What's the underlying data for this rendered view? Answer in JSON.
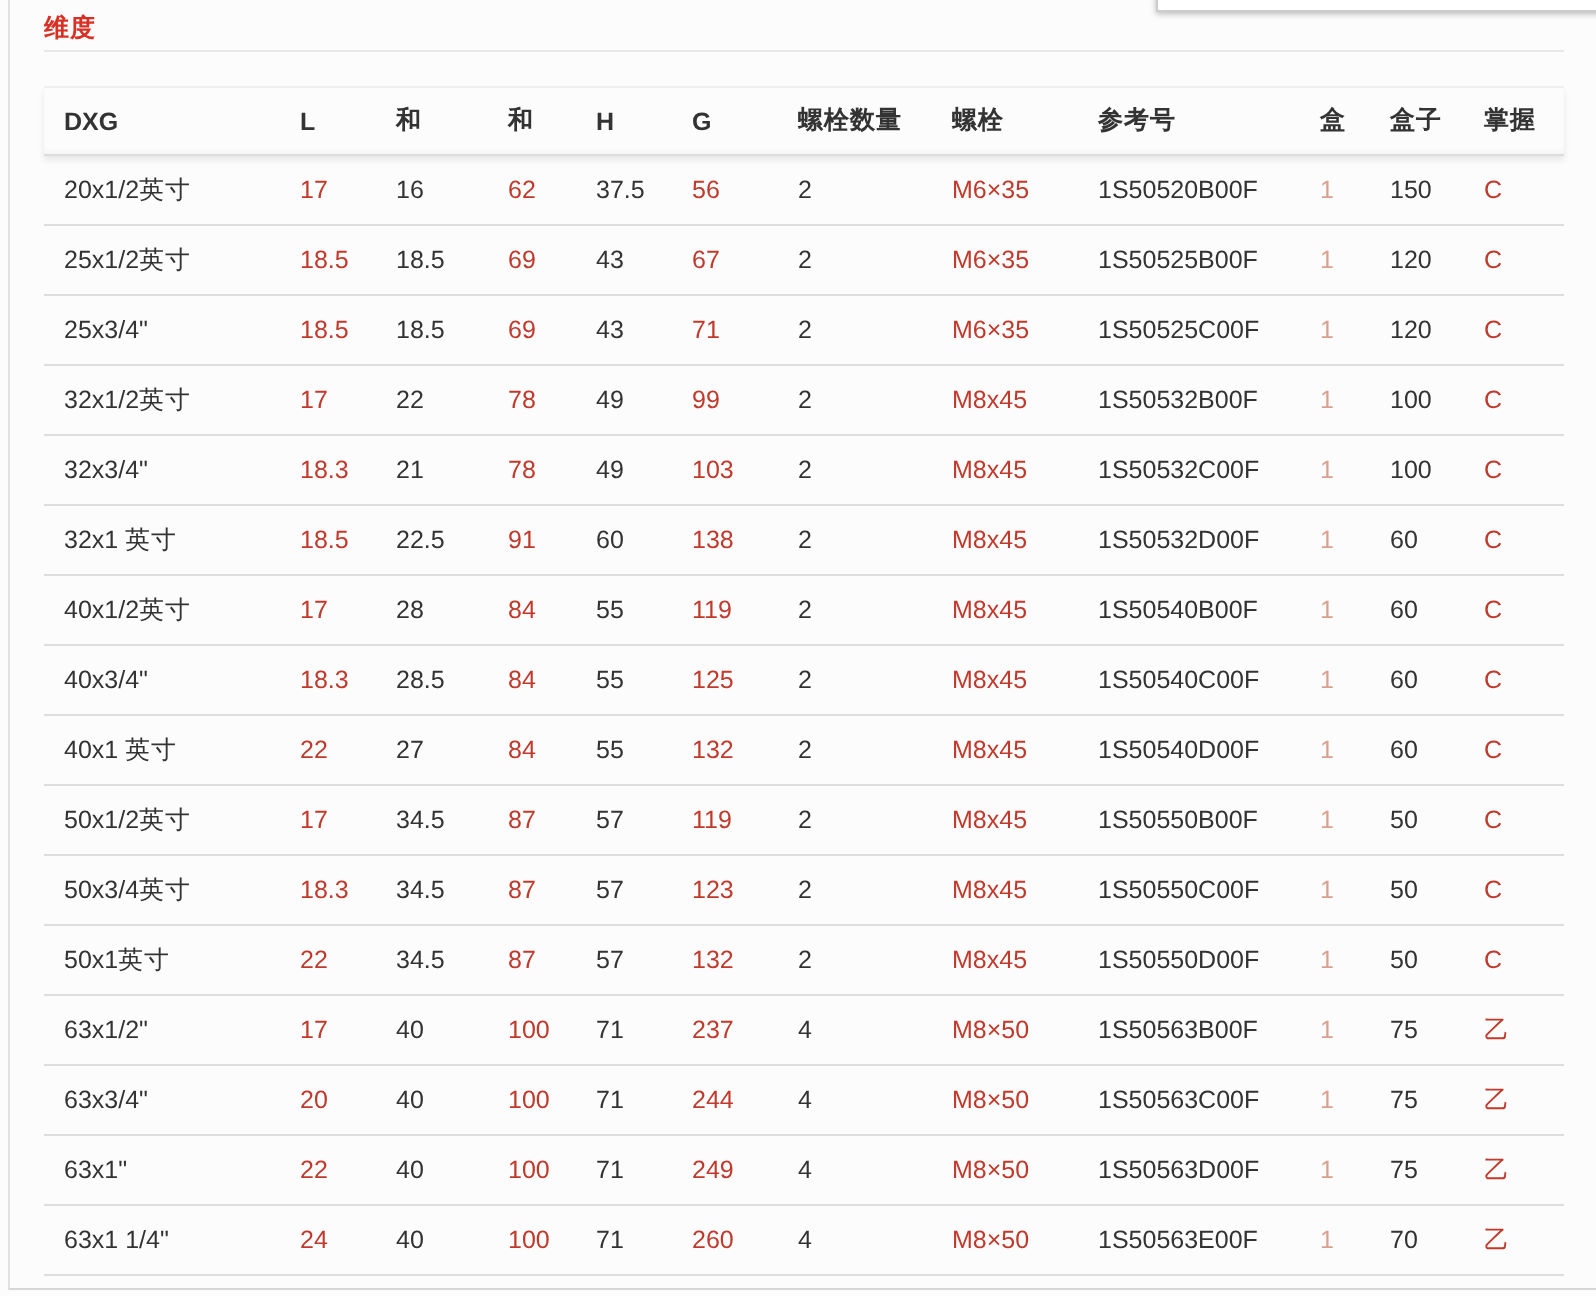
{
  "section_title": "维度",
  "table": {
    "columns": [
      {
        "label": "DXG",
        "color": "#333333"
      },
      {
        "label": "L",
        "color": "#c0392b"
      },
      {
        "label": "和",
        "color": "#333333"
      },
      {
        "label": "和",
        "color": "#c0392b"
      },
      {
        "label": "H",
        "color": "#333333"
      },
      {
        "label": "G",
        "color": "#c0392b"
      },
      {
        "label": "螺栓数量",
        "color": "#333333"
      },
      {
        "label": "螺栓",
        "color": "#c0392b"
      },
      {
        "label": "参考号",
        "color": "#333333"
      },
      {
        "label": "盒",
        "color": "#d9a08f"
      },
      {
        "label": "盒子",
        "color": "#333333"
      },
      {
        "label": "掌握",
        "color": "#c0392b"
      }
    ],
    "rows": [
      [
        "20x1/2英寸",
        "17",
        "16",
        "62",
        "37.5",
        "56",
        "2",
        "M6×35",
        "1S50520B00F",
        "1",
        "150",
        "C"
      ],
      [
        "25x1/2英寸",
        "18.5",
        "18.5",
        "69",
        "43",
        "67",
        "2",
        "M6×35",
        "1S50525B00F",
        "1",
        "120",
        "C"
      ],
      [
        "25x3/4\"",
        "18.5",
        "18.5",
        "69",
        "43",
        "71",
        "2",
        "M6×35",
        "1S50525C00F",
        "1",
        "120",
        "C"
      ],
      [
        "32x1/2英寸",
        "17",
        "22",
        "78",
        "49",
        "99",
        "2",
        "M8x45",
        "1S50532B00F",
        "1",
        "100",
        "C"
      ],
      [
        "32x3/4\"",
        "18.3",
        "21",
        "78",
        "49",
        "103",
        "2",
        "M8x45",
        "1S50532C00F",
        "1",
        "100",
        "C"
      ],
      [
        "32x1 英寸",
        "18.5",
        "22.5",
        "91",
        "60",
        "138",
        "2",
        "M8x45",
        "1S50532D00F",
        "1",
        "60",
        "C"
      ],
      [
        "40x1/2英寸",
        "17",
        "28",
        "84",
        "55",
        "119",
        "2",
        "M8x45",
        "1S50540B00F",
        "1",
        "60",
        "C"
      ],
      [
        "40x3/4\"",
        "18.3",
        "28.5",
        "84",
        "55",
        "125",
        "2",
        "M8x45",
        "1S50540C00F",
        "1",
        "60",
        "C"
      ],
      [
        "40x1 英寸",
        "22",
        "27",
        "84",
        "55",
        "132",
        "2",
        "M8x45",
        "1S50540D00F",
        "1",
        "60",
        "C"
      ],
      [
        "50x1/2英寸",
        "17",
        "34.5",
        "87",
        "57",
        "119",
        "2",
        "M8x45",
        "1S50550B00F",
        "1",
        "50",
        "C"
      ],
      [
        "50x3/4英寸",
        "18.3",
        "34.5",
        "87",
        "57",
        "123",
        "2",
        "M8x45",
        "1S50550C00F",
        "1",
        "50",
        "C"
      ],
      [
        "50x1英寸",
        "22",
        "34.5",
        "87",
        "57",
        "132",
        "2",
        "M8x45",
        "1S50550D00F",
        "1",
        "50",
        "C"
      ],
      [
        "63x1/2\"",
        "17",
        "40",
        "100",
        "71",
        "237",
        "4",
        "M8×50",
        "1S50563B00F",
        "1",
        "75",
        "乙"
      ],
      [
        "63x3/4\"",
        "20",
        "40",
        "100",
        "71",
        "244",
        "4",
        "M8×50",
        "1S50563C00F",
        "1",
        "75",
        "乙"
      ],
      [
        "63x1\"",
        "22",
        "40",
        "100",
        "71",
        "249",
        "4",
        "M8×50",
        "1S50563D00F",
        "1",
        "75",
        "乙"
      ],
      [
        "63x1 1/4\"",
        "24",
        "40",
        "100",
        "71",
        "260",
        "4",
        "M8×50",
        "1S50563E00F",
        "1",
        "70",
        "乙"
      ]
    ]
  }
}
